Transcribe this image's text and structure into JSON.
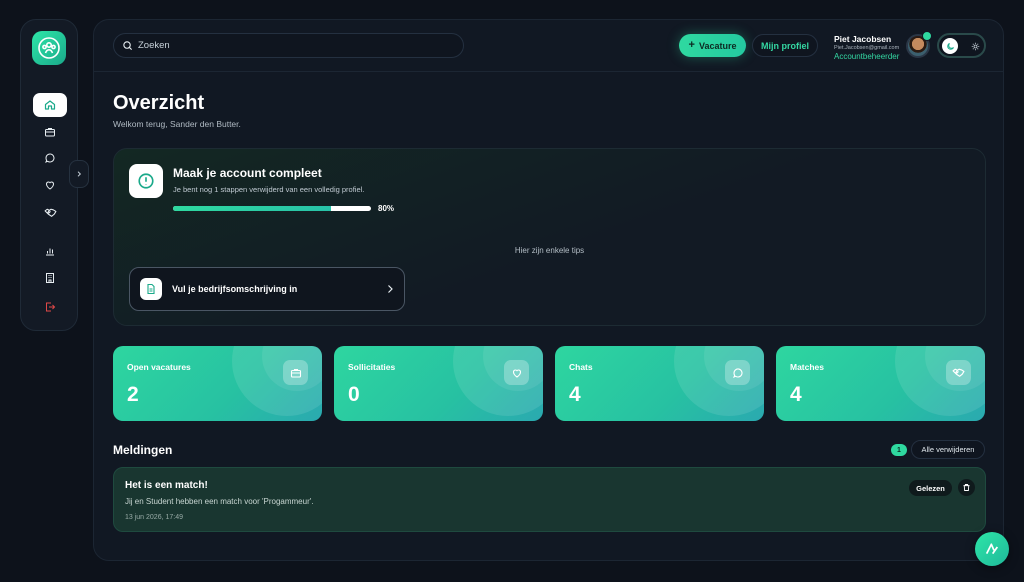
{
  "header": {
    "search_placeholder": "Zoeken",
    "add_vacancy_label": "Vacature",
    "profile_label": "Mijn profiel",
    "user": {
      "name": "Piet Jacobsen",
      "email": "Piet.Jacobsen@gmail.com",
      "role": "Accountbeheerder"
    }
  },
  "page": {
    "title": "Overzicht",
    "subtitle": "Welkom terug, Sander den Butter."
  },
  "profile_card": {
    "title": "Maak je account compleet",
    "description": "Je bent nog 1 stappen verwijderd van een volledig profiel.",
    "progress": 80,
    "progress_label": "80%",
    "tips_title": "Hier zijn enkele tips",
    "task_label": "Vul je bedrijfsomschrijving in"
  },
  "stats": [
    {
      "label": "Open vacatures",
      "value": "2",
      "icon": "briefcase-icon"
    },
    {
      "label": "Sollicitaties",
      "value": "0",
      "icon": "heart-icon"
    },
    {
      "label": "Chats",
      "value": "4",
      "icon": "chat-icon"
    },
    {
      "label": "Matches",
      "value": "4",
      "icon": "handshake-icon"
    }
  ],
  "notifications": {
    "title": "Meldingen",
    "count": "1",
    "clear_label": "Alle verwijderen",
    "items": [
      {
        "title": "Het is een match!",
        "text": "Jij en Student hebben een match voor 'Progammeur'.",
        "time": "13 jun 2026, 17:49",
        "read_label": "Gelezen"
      }
    ]
  },
  "colors": {
    "accent": "#2fd9a0",
    "background": "#0d121b",
    "panel": "#111823",
    "danger": "#e04848"
  },
  "sidebar": {
    "items": [
      {
        "icon": "home-icon",
        "active": true
      },
      {
        "icon": "briefcase-icon"
      },
      {
        "icon": "chat-icon"
      },
      {
        "icon": "heart-icon"
      },
      {
        "icon": "handshake-icon"
      },
      {
        "icon": "bar-chart-icon"
      },
      {
        "icon": "building-icon"
      },
      {
        "icon": "logout-icon"
      }
    ]
  }
}
